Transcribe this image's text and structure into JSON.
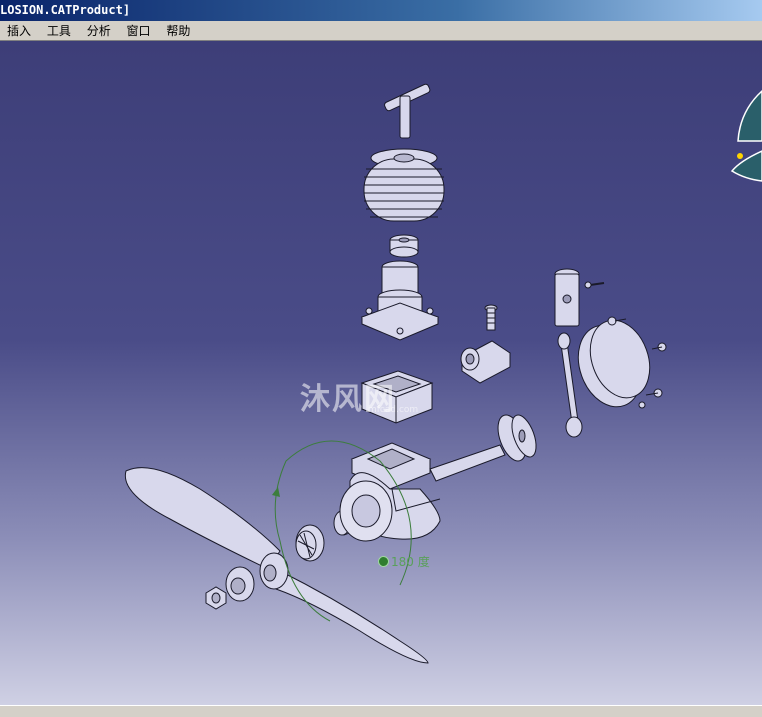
{
  "window": {
    "title": "LOSION.CATProduct]"
  },
  "menu": {
    "items": [
      "插入",
      "工具",
      "分析",
      "窗口",
      "帮助"
    ]
  },
  "viewport": {
    "angle_value": "180",
    "angle_unit": "度",
    "watermark": "沐风网",
    "watermark_url": "mfcad.com"
  },
  "colors": {
    "title_bar": "#0a246a",
    "background_top": "#3d3e78",
    "background_bottom": "#cfd0e4",
    "part_fill": "#d8d8ec",
    "part_edge": "#1a1a2a",
    "angle_green": "#5aa05a"
  },
  "icons": [
    "compass-icon",
    "angle-icon"
  ]
}
